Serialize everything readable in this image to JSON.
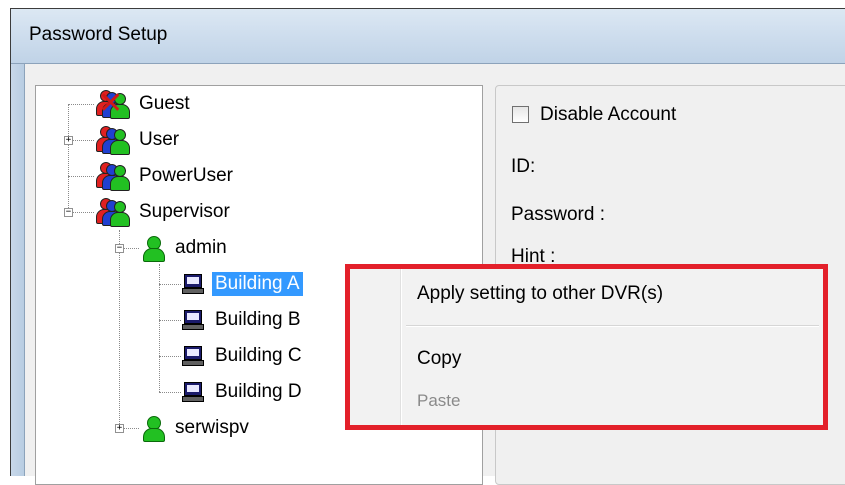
{
  "window": {
    "title": "Password Setup"
  },
  "tree": {
    "groups": [
      {
        "label": "Guest",
        "expander": ""
      },
      {
        "label": "User",
        "expander": "+"
      },
      {
        "label": "PowerUser",
        "expander": ""
      },
      {
        "label": "Supervisor",
        "expander": "−"
      }
    ],
    "admin": {
      "label": "admin",
      "expander": "−"
    },
    "devices": [
      {
        "label": "Building A",
        "selected": true
      },
      {
        "label": "Building B"
      },
      {
        "label": "Building C"
      },
      {
        "label": "Building D"
      }
    ],
    "serwispv": {
      "label": "serwispv",
      "expander": "+"
    }
  },
  "account": {
    "disable_label": "Disable Account",
    "disable_checked": false,
    "id_label": "ID:",
    "password_label": "Password :",
    "hint_label": "Hint :"
  },
  "context_menu": {
    "items": [
      {
        "label": "Apply setting to other DVR(s)",
        "enabled": true
      },
      {
        "label": "Copy",
        "enabled": true
      },
      {
        "label": "Paste",
        "enabled": false
      }
    ],
    "highlight_color": "#e3202a"
  },
  "colors": {
    "selection": "#3399ff",
    "titlebar": "#cfdeee"
  }
}
